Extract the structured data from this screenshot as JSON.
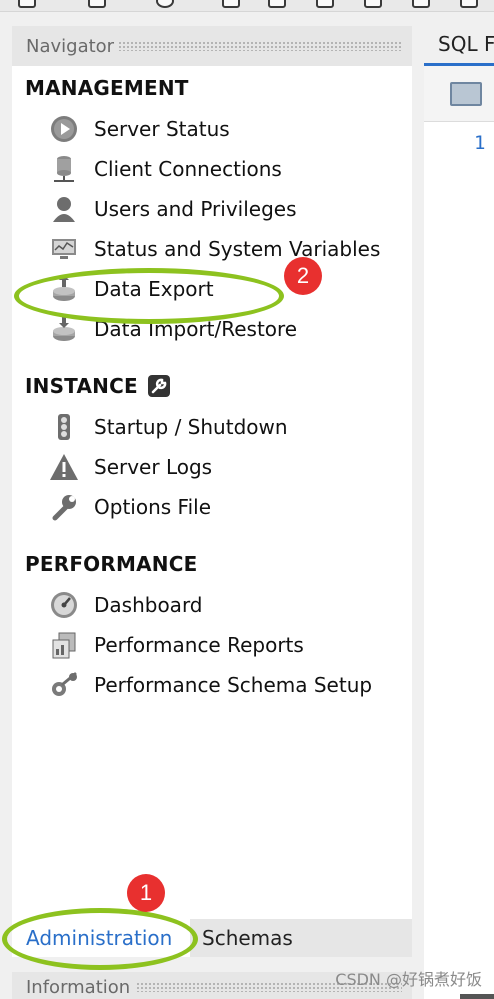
{
  "navigator": {
    "header": "Navigator",
    "sections": [
      {
        "title": "MANAGEMENT",
        "items": [
          {
            "label": "Server Status",
            "icon": "play-circle-icon"
          },
          {
            "label": "Client Connections",
            "icon": "database-connections-icon"
          },
          {
            "label": "Users and Privileges",
            "icon": "user-icon"
          },
          {
            "label": "Status and System Variables",
            "icon": "monitor-icon"
          },
          {
            "label": "Data Export",
            "icon": "export-icon"
          },
          {
            "label": "Data Import/Restore",
            "icon": "import-icon"
          }
        ]
      },
      {
        "title": "INSTANCE",
        "title_icon": "wrench-icon",
        "items": [
          {
            "label": "Startup / Shutdown",
            "icon": "traffic-light-icon"
          },
          {
            "label": "Server Logs",
            "icon": "warning-icon"
          },
          {
            "label": "Options File",
            "icon": "wrench-icon"
          }
        ]
      },
      {
        "title": "PERFORMANCE",
        "items": [
          {
            "label": "Dashboard",
            "icon": "gauge-icon"
          },
          {
            "label": "Performance Reports",
            "icon": "reports-icon"
          },
          {
            "label": "Performance Schema Setup",
            "icon": "schema-setup-icon"
          }
        ]
      }
    ]
  },
  "tabs": {
    "administration": "Administration",
    "schemas": "Schemas"
  },
  "information": {
    "header": "Information"
  },
  "editor": {
    "tab_label": "SQL F",
    "line_number": "1"
  },
  "annotations": {
    "badge_1": "1",
    "badge_2": "2",
    "highlight_color": "#8dc21f",
    "badge_color": "#e8302f"
  },
  "watermark": "CSDN @好锅煮好饭",
  "colors": {
    "accent": "#2a6fc9",
    "panel": "#e6e6e6",
    "body": "#ffffff"
  }
}
